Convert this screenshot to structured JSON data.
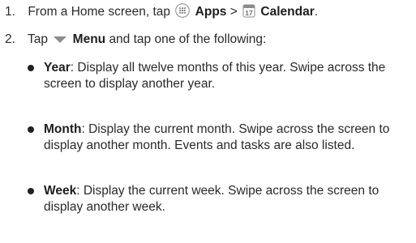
{
  "steps": [
    {
      "number": "1.",
      "prefix": "From a Home screen, tap",
      "apps_label": "Apps",
      "separator": ">",
      "calendar_label": "Calendar",
      "suffix": ".",
      "apps_icon": "apps-grid-icon",
      "calendar_icon": "calendar-17-icon"
    },
    {
      "number": "2.",
      "prefix": "Tap",
      "menu_label": "Menu",
      "suffix": "and tap one of the following:",
      "menu_icon": "menu-triangle-icon"
    }
  ],
  "calendar_icon_day": "17",
  "options": [
    {
      "term": "Year",
      "text": ": Display all twelve months of this year. Swipe across the screen to display another year."
    },
    {
      "term": "Month",
      "text": ": Display the current month. Swipe across the screen to display another month. Events and tasks are also listed."
    },
    {
      "term": "Week",
      "text": ": Display the current week. Swipe across the screen to display another week."
    }
  ],
  "colors": {
    "text": "#2a2a2a",
    "icon_gray": "#8c8c8c"
  }
}
